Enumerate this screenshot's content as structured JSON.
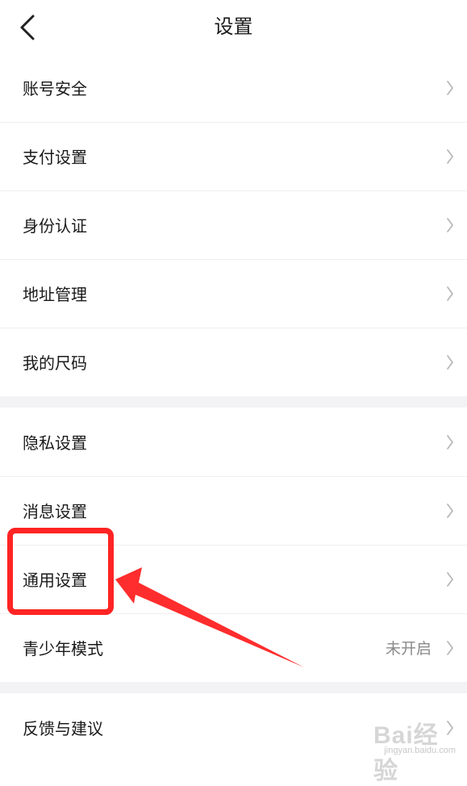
{
  "header": {
    "title": "设置"
  },
  "groups": [
    {
      "items": [
        {
          "label": "账号安全"
        },
        {
          "label": "支付设置"
        },
        {
          "label": "身份认证"
        },
        {
          "label": "地址管理"
        },
        {
          "label": "我的尺码"
        }
      ]
    },
    {
      "items": [
        {
          "label": "隐私设置"
        },
        {
          "label": "消息设置"
        },
        {
          "label": "通用设置"
        },
        {
          "label": "青少年模式",
          "value": "未开启"
        }
      ]
    },
    {
      "items": [
        {
          "label": "反馈与建议"
        }
      ]
    }
  ],
  "icons": {
    "back": "chevron-left-icon",
    "row_arrow": "chevron-right-icon"
  },
  "colors": {
    "background": "#ffffff",
    "separator": "#f3f3f5",
    "text": "#1a1a1a",
    "secondary_text": "#8a8a8a",
    "chevron": "#b8b8b8",
    "annotation": "#ff2424"
  },
  "watermark": {
    "text": "Bai经验",
    "url": "jingyan.baidu.com"
  }
}
